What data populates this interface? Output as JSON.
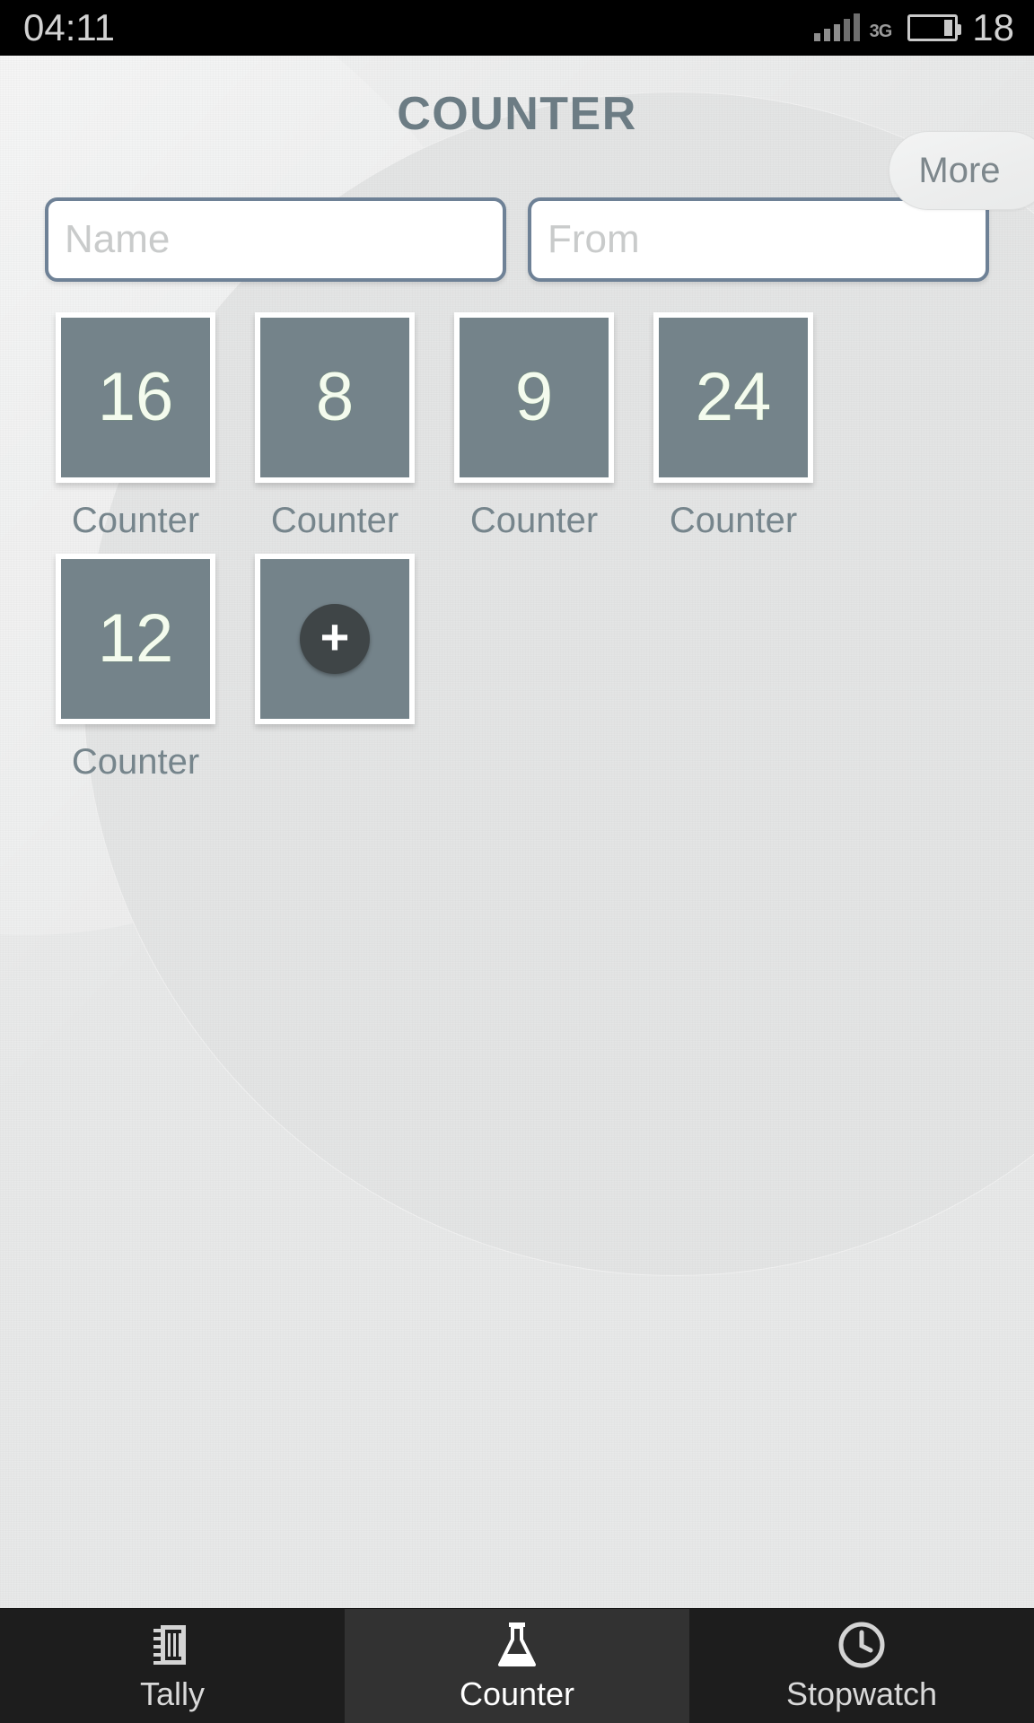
{
  "status_bar": {
    "time": "04:11",
    "network_type": "3G",
    "battery_level": "18",
    "signal_icon": "signal-bars-icon",
    "battery_icon": "battery-icon"
  },
  "header": {
    "title": "COUNTER",
    "more_label": "More"
  },
  "form": {
    "name_placeholder": "Name",
    "from_placeholder": "From",
    "name_value": "",
    "from_value": ""
  },
  "counters": [
    {
      "value": "16",
      "label": "Counter"
    },
    {
      "value": "8",
      "label": "Counter"
    },
    {
      "value": "9",
      "label": "Counter"
    },
    {
      "value": "24",
      "label": "Counter"
    },
    {
      "value": "12",
      "label": "Counter"
    }
  ],
  "add_tile": {
    "icon": "plus-icon",
    "glyph": "+",
    "label": ""
  },
  "tabs": [
    {
      "label": "Tally",
      "icon": "notebook-icon",
      "active": false
    },
    {
      "label": "Counter",
      "icon": "flask-icon",
      "active": true
    },
    {
      "label": "Stopwatch",
      "icon": "clock-icon",
      "active": false
    }
  ],
  "colors": {
    "tile_fill": "#74838a",
    "tile_number": "#f4fbee",
    "title": "#6c7c84",
    "field_border": "#6e8196",
    "background": "#e8e9e9",
    "tabbar": "#1d1d1d",
    "tab_active": "#323232"
  }
}
